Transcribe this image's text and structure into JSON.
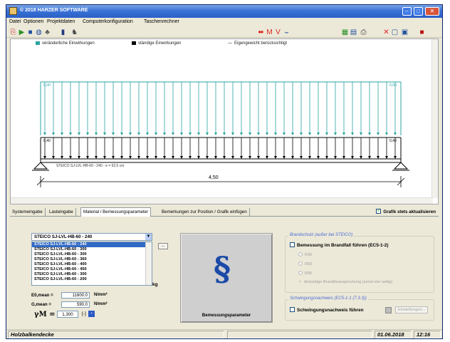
{
  "window": {
    "title": "© 2018 HARZER SOFTWARE",
    "controls": {
      "minimize": "–",
      "maximize": "□",
      "close": "✕"
    }
  },
  "menu": [
    "Datei",
    "Optionen",
    "Projektdaten",
    "Computerkonfiguration",
    "Taschenrechner"
  ],
  "toolbar": {
    "icons": [
      "new-icon",
      "open-icon",
      "save-icon",
      "print-preview-icon",
      "print-icon",
      "book-icon",
      "person-icon",
      "load-arrow-icon",
      "moment-icon",
      "shear-icon",
      "deflection-icon",
      "table-icon",
      "report-icon",
      "printer-icon",
      "delete-icon",
      "info-icon",
      "window-icon",
      "disk-icon"
    ]
  },
  "canvas": {
    "legend": {
      "variable_loads": "veränderliche Einwirkungen",
      "permanent_loads": "ständige Einwirkungen",
      "self_weight": "Eigengewicht berücksichtigt"
    },
    "var_load_left": "0,00",
    "var_load_right": "0,00",
    "perm_load_left": "0,40",
    "perm_load_right": "0,40",
    "beam_label": "STEICO SJ-LVL-HB-60 - 240 - e = 62,5 cm",
    "span": "4,50",
    "colors": {
      "variable": "#2ba3a0",
      "permanent": "#000000"
    }
  },
  "tabs": {
    "items": [
      "Systemeingabe",
      "Lasteingabe",
      "Material / Bemessungsparameter",
      "Bemerkungen zur Position / Grafik einfügen"
    ],
    "active_index": 2,
    "graph_update_label": "Grafik stets aktualisieren",
    "graph_update_checked": true
  },
  "material": {
    "selected_profile": "STEICO SJ-LVL-HB-60 - 240",
    "profiles": [
      "STEICO SJ-LVL-HB-60 - 240",
      "STEICO SJ-LVL-HB-60 - 300",
      "STEICO SJ-LVL-HB-60 - 300",
      "STEICO SJ-LVL-HB-60 - 360",
      "STEICO SJ-LVL-HB-60 - 400",
      "STEICO SJ-LVL-HB-60 - 450",
      "STEICO SJ-LVL-HB-60 - 300",
      "STEICO SJ-LVL-HB-60 - 200"
    ],
    "dots_button": "...",
    "kg_label": "kg",
    "e0mean_label": "E0,mean =",
    "e0mean_value": "11600.0",
    "e0mean_unit": "N/mm²",
    "gmean_label": "G,mean =",
    "gmean_value": "590.0",
    "gmean_unit": "N/mm²",
    "gamma_label": "γM =",
    "gamma_value": "1,300",
    "gamma_unit": "[-]",
    "bemessung_button": "Bemessungsparameter"
  },
  "fire": {
    "group_title": "Brandschutz (außer bei STEICO)",
    "checkbox_label": "Bemessung im Brandfall führen (EC5-1-2)",
    "options": [
      "R30",
      "R60",
      "R90"
    ],
    "extra_option": "dreiseitige Brandbeanspruchung (sonst vier seitig)"
  },
  "vibration": {
    "group_title": "Schwingungsnachweis (EC5-1-1 (7.3.3))",
    "checkbox_label": "Schwingungsnachweis führen",
    "settings_button": "Einstellungen..."
  },
  "status": {
    "position_name": "Holzbalkendecke",
    "date": "01.06.2018",
    "time": "12:16"
  }
}
